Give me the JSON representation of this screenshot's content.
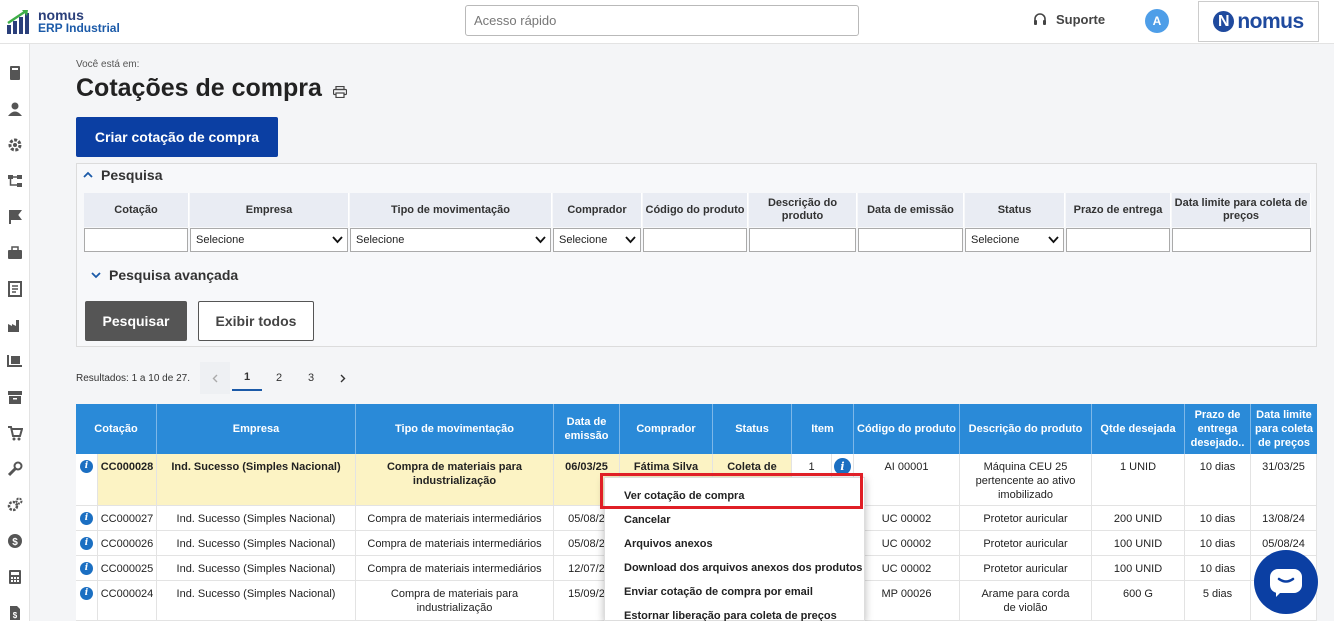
{
  "header": {
    "logo_line1": "nomus",
    "logo_line2": "ERP Industrial",
    "quick_access_placeholder": "Acesso rápido",
    "support_label": "Suporte",
    "avatar_initial": "A",
    "brand_letter": "N",
    "brand_text": "nomus"
  },
  "sidebar": {
    "icons": [
      "book-icon",
      "user-icon",
      "gear-icon",
      "flow-icon",
      "flag-icon",
      "briefcase-icon",
      "document-icon",
      "factory-icon",
      "pallet-icon",
      "archive-icon",
      "cart-icon",
      "tool-icon",
      "gears-icon",
      "dollar-icon",
      "calculator-icon",
      "file-dollar-icon"
    ]
  },
  "page": {
    "breadcrumb": "Você está em:",
    "title": "Cotações de compra",
    "create_button": "Criar cotação de compra"
  },
  "search": {
    "title": "Pesquisa",
    "advanced_title": "Pesquisa avançada",
    "filters": [
      {
        "label": "Cotação",
        "value": ""
      },
      {
        "label": "Empresa",
        "value": "Selecione"
      },
      {
        "label": "Tipo de movimentação",
        "value": "Selecione"
      },
      {
        "label": "Comprador",
        "value": "Selecione"
      },
      {
        "label": "Código do produto",
        "value": ""
      },
      {
        "label": "Descrição do produto",
        "value": ""
      },
      {
        "label": "Data de emissão",
        "value": ""
      },
      {
        "label": "Status",
        "value": "Selecione"
      },
      {
        "label": "Prazo de entrega",
        "value": ""
      },
      {
        "label": "Data limite para coleta de preços",
        "value": ""
      }
    ],
    "search_button": "Pesquisar",
    "show_all_button": "Exibir todos"
  },
  "results": {
    "summary": "Resultados: 1 a 10 de 27.",
    "pages": [
      "1",
      "2",
      "3"
    ],
    "current_page": "1"
  },
  "table": {
    "headers": [
      "Cotação",
      "Empresa",
      "Tipo de movimentação",
      "Data de emissão",
      "Comprador",
      "Status",
      "Item",
      "Código do produto",
      "Descrição do produto",
      "Qtde desejada",
      "Prazo de entrega desejado..",
      "Data limite para coleta de preços"
    ],
    "rows": [
      {
        "cotacao": "CC000028",
        "empresa": "Ind. Sucesso (Simples Nacional)",
        "tipo": "Compra de materiais para industrialização",
        "data": "06/03/25",
        "comprador": "Fátima Silva",
        "status": "Coleta de",
        "item": "1",
        "codigo": "AI 00001",
        "descricao": "Máquina CEU 25 pertencente ao ativo imobilizado",
        "qtde": "1 UNID",
        "prazo": "10 dias",
        "limite": "31/03/25"
      },
      {
        "cotacao": "CC000027",
        "empresa": "Ind. Sucesso (Simples Nacional)",
        "tipo": "Compra de materiais intermediários",
        "data": "05/08/2",
        "comprador": "",
        "status": "",
        "item": "",
        "codigo": "UC 00002",
        "descricao": "Protetor auricular",
        "qtde": "200 UNID",
        "prazo": "10 dias",
        "limite": "13/08/24"
      },
      {
        "cotacao": "CC000026",
        "empresa": "Ind. Sucesso (Simples Nacional)",
        "tipo": "Compra de materiais intermediários",
        "data": "05/08/2",
        "comprador": "",
        "status": "",
        "item": "",
        "codigo": "UC 00002",
        "descricao": "Protetor auricular",
        "qtde": "100 UNID",
        "prazo": "10 dias",
        "limite": "05/08/24"
      },
      {
        "cotacao": "CC000025",
        "empresa": "Ind. Sucesso (Simples Nacional)",
        "tipo": "Compra de materiais intermediários",
        "data": "12/07/2",
        "comprador": "",
        "status": "",
        "item": "",
        "codigo": "UC 00002",
        "descricao": "Protetor auricular",
        "qtde": "100 UNID",
        "prazo": "10 dias",
        "limite": ""
      },
      {
        "cotacao": "CC000024",
        "empresa": "Ind. Sucesso (Simples Nacional)",
        "tipo": "Compra de materiais para industrialização",
        "data": "15/09/2",
        "comprador": "",
        "status": "",
        "item": "",
        "codigo": "MP 00026",
        "descricao": "Arame para corda de violão",
        "qtde": "600 G",
        "prazo": "5 dias",
        "limite": ""
      }
    ]
  },
  "context_menu": {
    "items": [
      "Ver cotação de compra",
      "Cancelar",
      "Arquivos anexos",
      "Download dos arquivos anexos dos produtos",
      "Enviar cotação de compra por email",
      "Estornar liberação para coleta de preços"
    ]
  },
  "colors": {
    "primary": "#0b3fa3",
    "table_header": "#2a8ad8",
    "highlight_row": "#fcf3c4",
    "annotation": "#e01f26"
  }
}
